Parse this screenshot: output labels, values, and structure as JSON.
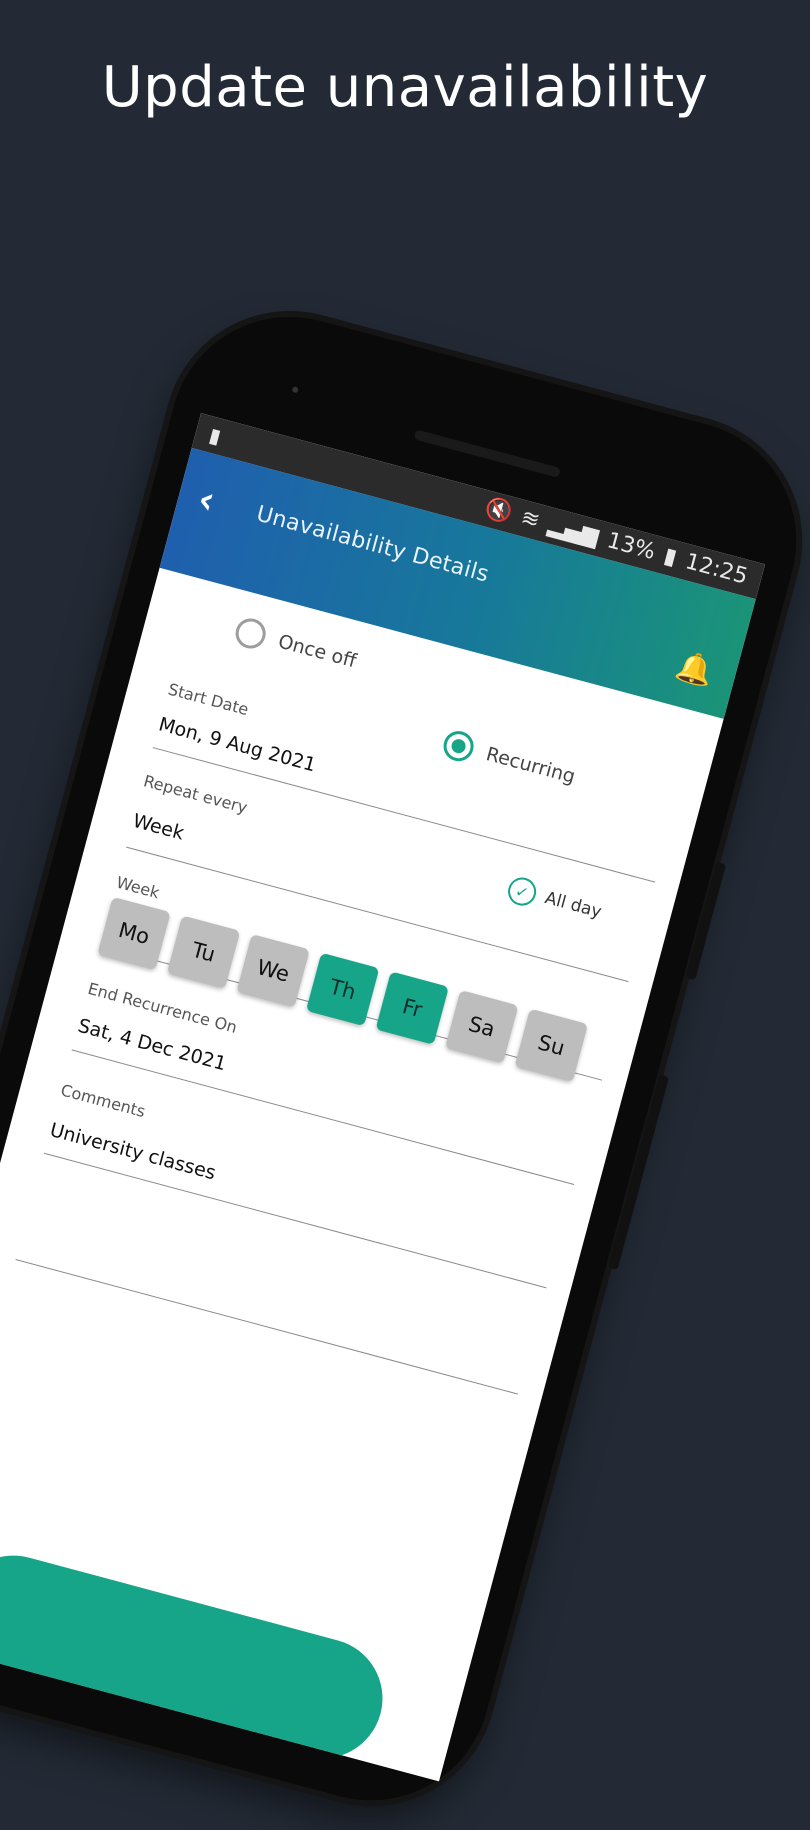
{
  "headline": "Update unavailability",
  "statusbar": {
    "left_icon": "battery-alert-icon",
    "battery": "13%",
    "time": "12:25"
  },
  "appbar": {
    "title": "Unavailability Details",
    "back_icon": "chevron-left-icon",
    "bell_icon": "bell-icon"
  },
  "form": {
    "once_off_label": "Once off",
    "recurring_label": "Recurring",
    "selected": "Recurring",
    "start_date_label": "Start Date",
    "start_date_value": "Mon, 9 Aug 2021",
    "all_day_label": "All day",
    "all_day_checked": true,
    "repeat_label": "Repeat every",
    "repeat_value": "Week",
    "week_label": "Week",
    "days": [
      {
        "label": "Mo",
        "selected": false
      },
      {
        "label": "Tu",
        "selected": false
      },
      {
        "label": "We",
        "selected": false
      },
      {
        "label": "Th",
        "selected": true
      },
      {
        "label": "Fr",
        "selected": true
      },
      {
        "label": "Sa",
        "selected": false
      },
      {
        "label": "Su",
        "selected": false
      }
    ],
    "end_label": "End Recurrence On",
    "end_value": "Sat, 4 Dec 2021",
    "comments_label": "Comments",
    "comments_value": "University classes"
  },
  "colors": {
    "background": "#232a35",
    "accent": "#17a589",
    "appbar_start": "#1f5fae",
    "appbar_end": "#1a9478",
    "day_inactive": "#bdbdbd"
  }
}
